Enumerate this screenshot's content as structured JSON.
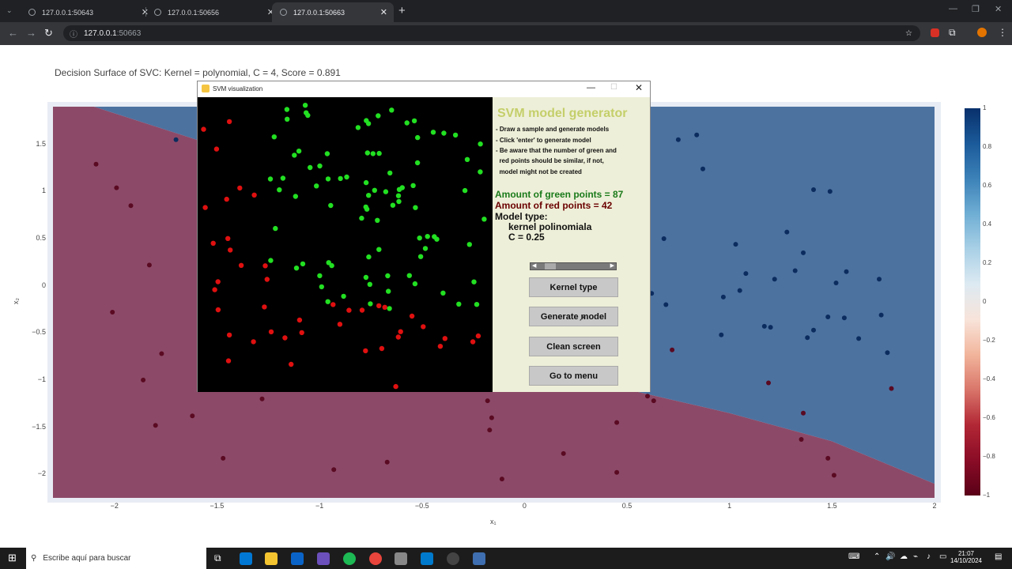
{
  "browser": {
    "tabs": [
      {
        "title": "127.0.0.1:50643",
        "active": false
      },
      {
        "title": "127.0.0.1:50656",
        "active": false
      },
      {
        "title": "127.0.0.1:50663",
        "active": true
      }
    ],
    "address_host": "127.0.0.1",
    "address_port": ":50663"
  },
  "plot": {
    "title": "Decision Surface of SVC: Kernel = polynomial, C = 4, Score = 0.891",
    "xlabel": "x₁",
    "ylabel": "x₂",
    "xticks": [
      "−2",
      "−1.5",
      "−1",
      "−0.5",
      "0",
      "0.5",
      "1",
      "1.5",
      "2"
    ],
    "yticks": [
      "1.5",
      "1",
      "0.5",
      "0",
      "−0.5",
      "−1",
      "−1.5",
      "−2"
    ],
    "colorbar_ticks": [
      "1",
      "0.8",
      "0.6",
      "0.4",
      "0.2",
      "0",
      "−0.2",
      "−0.4",
      "−0.6",
      "−0.8",
      "−1"
    ],
    "colors": {
      "positive": "#4c72a0",
      "negative": "#8c4a68",
      "point_pos": "#0b2c5e",
      "point_neg": "#5a0a22"
    }
  },
  "chart_data": {
    "type": "scatter",
    "title": "Decision Surface of SVC: Kernel = polynomial, C = 4, Score = 0.891",
    "xlabel": "x₁",
    "ylabel": "x₂",
    "xlim": [
      -2.3,
      2.0
    ],
    "ylim": [
      -2.25,
      1.9
    ],
    "boundary": [
      [
        -2.1,
        1.9
      ],
      [
        -1.6,
        1.55
      ],
      [
        -1.0,
        1.22
      ],
      [
        -0.5,
        0.9
      ],
      [
        0.0,
        0.2
      ],
      [
        0.5,
        -1.1
      ],
      [
        1.0,
        -1.35
      ],
      [
        1.5,
        -1.65
      ],
      [
        2.0,
        -2.1
      ]
    ],
    "series": [
      {
        "label": "1",
        "color": "#0b2c5e",
        "points": [
          [
            0.75,
            1.55
          ],
          [
            0.84,
            1.6
          ],
          [
            0.87,
            1.24
          ],
          [
            1.41,
            1.02
          ],
          [
            1.49,
            1.0
          ],
          [
            1.28,
            0.57
          ],
          [
            1.03,
            0.44
          ],
          [
            1.36,
            0.35
          ],
          [
            0.68,
            0.5
          ],
          [
            1.32,
            0.16
          ],
          [
            1.08,
            0.13
          ],
          [
            1.22,
            0.07
          ],
          [
            1.52,
            0.03
          ],
          [
            1.57,
            0.15
          ],
          [
            1.73,
            0.07
          ],
          [
            1.05,
            -0.05
          ],
          [
            0.97,
            -0.12
          ],
          [
            0.69,
            -0.2
          ],
          [
            0.62,
            -0.08
          ],
          [
            1.17,
            -0.43
          ],
          [
            1.2,
            -0.44
          ],
          [
            1.41,
            -0.47
          ],
          [
            1.38,
            -0.55
          ],
          [
            0.96,
            -0.52
          ],
          [
            1.48,
            -0.33
          ],
          [
            1.56,
            -0.34
          ],
          [
            1.63,
            -0.56
          ],
          [
            1.74,
            -0.31
          ],
          [
            1.77,
            -0.71
          ],
          [
            -1.7,
            1.55
          ]
        ]
      },
      {
        "label": "-1",
        "color": "#5a0a22",
        "points": [
          [
            -2.09,
            1.29
          ],
          [
            -1.99,
            1.04
          ],
          [
            -1.92,
            0.85
          ],
          [
            -1.83,
            0.22
          ],
          [
            -2.01,
            -0.28
          ],
          [
            -1.77,
            -0.72
          ],
          [
            -1.86,
            -1.0
          ],
          [
            -1.8,
            -1.48
          ],
          [
            -1.62,
            -1.38
          ],
          [
            -1.47,
            -1.83
          ],
          [
            -1.28,
            -1.2
          ],
          [
            -0.93,
            -1.95
          ],
          [
            -0.67,
            -1.87
          ],
          [
            -0.18,
            -1.22
          ],
          [
            -0.16,
            -1.4
          ],
          [
            -0.17,
            -1.53
          ],
          [
            -0.11,
            -2.05
          ],
          [
            0.19,
            -1.78
          ],
          [
            0.45,
            -1.45
          ],
          [
            0.45,
            -1.98
          ],
          [
            0.6,
            -1.17
          ],
          [
            0.63,
            -1.22
          ],
          [
            0.72,
            -0.68
          ],
          [
            1.19,
            -1.03
          ],
          [
            1.36,
            -1.35
          ],
          [
            1.35,
            -1.63
          ],
          [
            1.48,
            -1.83
          ],
          [
            1.51,
            -2.01
          ],
          [
            1.79,
            -1.09
          ]
        ]
      }
    ]
  },
  "pywindow": {
    "title": "SVM visualization",
    "header": "SVM model generator",
    "instructions": [
      "- Draw a sample and generate models",
      "- Click 'enter' to generate model",
      "- Be aware that the number of green and",
      "  red points should be similar, if not,",
      "  model might not be created"
    ],
    "green_count_text": "Amount of green points = 87",
    "red_count_text": "Amount of red points = 42",
    "model_type_label": "Model type:",
    "model_type_value": "kernel polinomiala",
    "c_value_text": "C = 0.25",
    "buttons": {
      "kernel": "Kernel type",
      "generate": "Generate model",
      "clean": "Clean screen",
      "menu": "Go to menu"
    },
    "colors": {
      "header": "#c4cf6a",
      "green_text": "#1a7a1a",
      "red_text": "#6a0000",
      "panel_bg": "#eeefd8"
    }
  },
  "taskbar": {
    "search_placeholder": "Escribe aquí para buscar",
    "time": "21:07",
    "date": "14/10/2024"
  }
}
